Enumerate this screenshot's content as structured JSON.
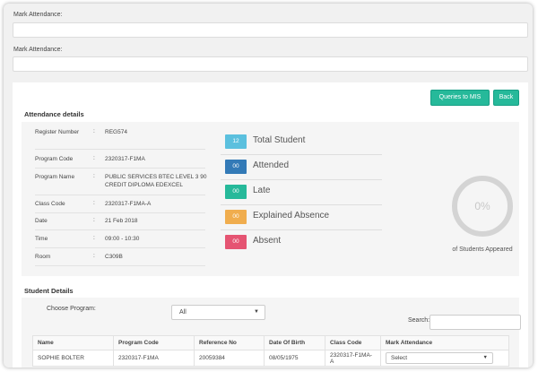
{
  "form": {
    "field1_label": "Mark Attendance:",
    "field2_label": "Mark Attendance:"
  },
  "actions": {
    "queries_label": "Queries to MIS",
    "back_label": "Back"
  },
  "details": {
    "title": "Attendance details",
    "rows": [
      {
        "label": "Register Number",
        "value": "REG574"
      },
      {
        "label": "Program Code",
        "value": "2320317-F1MA"
      },
      {
        "label": "Program Name",
        "value": "PUBLIC SERVICES BTEC LEVEL 3 90 CREDIT DIPLOMA EDEXCEL"
      },
      {
        "label": "Class Code",
        "value": "2320317-F1MA-A"
      },
      {
        "label": "Date",
        "value": "21 Feb 2018"
      },
      {
        "label": "Time",
        "value": "09:00 - 10:30"
      },
      {
        "label": "Room",
        "value": "C309B"
      }
    ],
    "colon": ":"
  },
  "stats": [
    {
      "count": "12",
      "label": "Total Student",
      "color": "#5bc0de"
    },
    {
      "count": "00",
      "label": "Attended",
      "color": "#337ab7"
    },
    {
      "count": "00",
      "label": "Late",
      "color": "#26b99a"
    },
    {
      "count": "00",
      "label": "Explained Absence",
      "color": "#f0ad4e"
    },
    {
      "count": "00",
      "label": "Absent",
      "color": "#e55472"
    }
  ],
  "appeared": {
    "percent": "0%",
    "caption": "of Students Appeared"
  },
  "students": {
    "title": "Student Details",
    "choose_program_label": "Choose Program:",
    "program_selected": "All",
    "search_label": "Search:",
    "search_value": "",
    "columns": [
      "Name",
      "Program Code",
      "Reference No",
      "Date Of Birth",
      "Class Code",
      "Mark Attendance"
    ],
    "rows": [
      {
        "name": "SOPHIE BOLTER",
        "program_code": "2320317-F1MA",
        "reference_no": "20059384",
        "dob": "08/05/1975",
        "class_code": "2320317-F1MA-A",
        "mark": "Select"
      }
    ]
  },
  "icons": {
    "dropdown": "caret-down-icon"
  }
}
